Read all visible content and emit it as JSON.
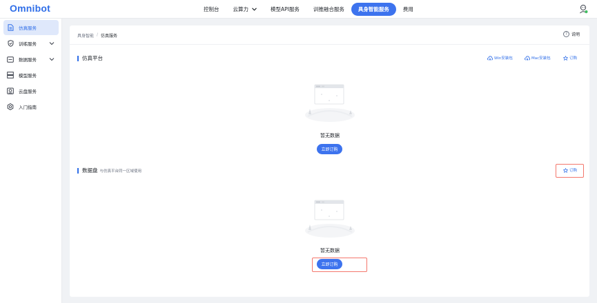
{
  "app": {
    "logo": "Omnibot"
  },
  "nav": {
    "items": [
      {
        "label": "控制台",
        "active": false,
        "dropdown": false
      },
      {
        "label": "云算力",
        "active": false,
        "dropdown": true
      },
      {
        "label": "模型API服务",
        "active": false,
        "dropdown": false
      },
      {
        "label": "训推融合服务",
        "active": false,
        "dropdown": false
      },
      {
        "label": "具身智能服务",
        "active": true,
        "dropdown": false
      },
      {
        "label": "费用",
        "active": false,
        "dropdown": false
      }
    ]
  },
  "sidebar": {
    "items": [
      {
        "label": "仿真服务",
        "icon": "document-icon",
        "active": true,
        "expandable": false
      },
      {
        "label": "训练服务",
        "icon": "shield-icon",
        "active": false,
        "expandable": true
      },
      {
        "label": "数据服务",
        "icon": "database-icon",
        "active": false,
        "expandable": true
      },
      {
        "label": "模型服务",
        "icon": "server-icon",
        "active": false,
        "expandable": false
      },
      {
        "label": "云盘服务",
        "icon": "cloud-disk-icon",
        "active": false,
        "expandable": false
      },
      {
        "label": "入门指南",
        "icon": "gear-icon",
        "active": false,
        "expandable": false
      }
    ]
  },
  "breadcrumb": {
    "parent": "具身智能",
    "separator": "/",
    "current": "仿真服务"
  },
  "help": {
    "label": "说明"
  },
  "sections": {
    "platform": {
      "title": "仿真平台",
      "win_label": "Win安装包",
      "mac_label": "Mac安装包",
      "subscribe_label": "订购",
      "empty_text": "暂无数据",
      "button_label": "立即订购"
    },
    "disk": {
      "title": "数据盘",
      "subtitle": "与仿真平台同一区域使用",
      "subscribe_label": "订购",
      "empty_text": "暂无数据",
      "button_label": "立即订购"
    }
  },
  "colors": {
    "primary": "#3d73ee",
    "highlight": "#f4766b",
    "active_bg": "#dfe8fb"
  }
}
